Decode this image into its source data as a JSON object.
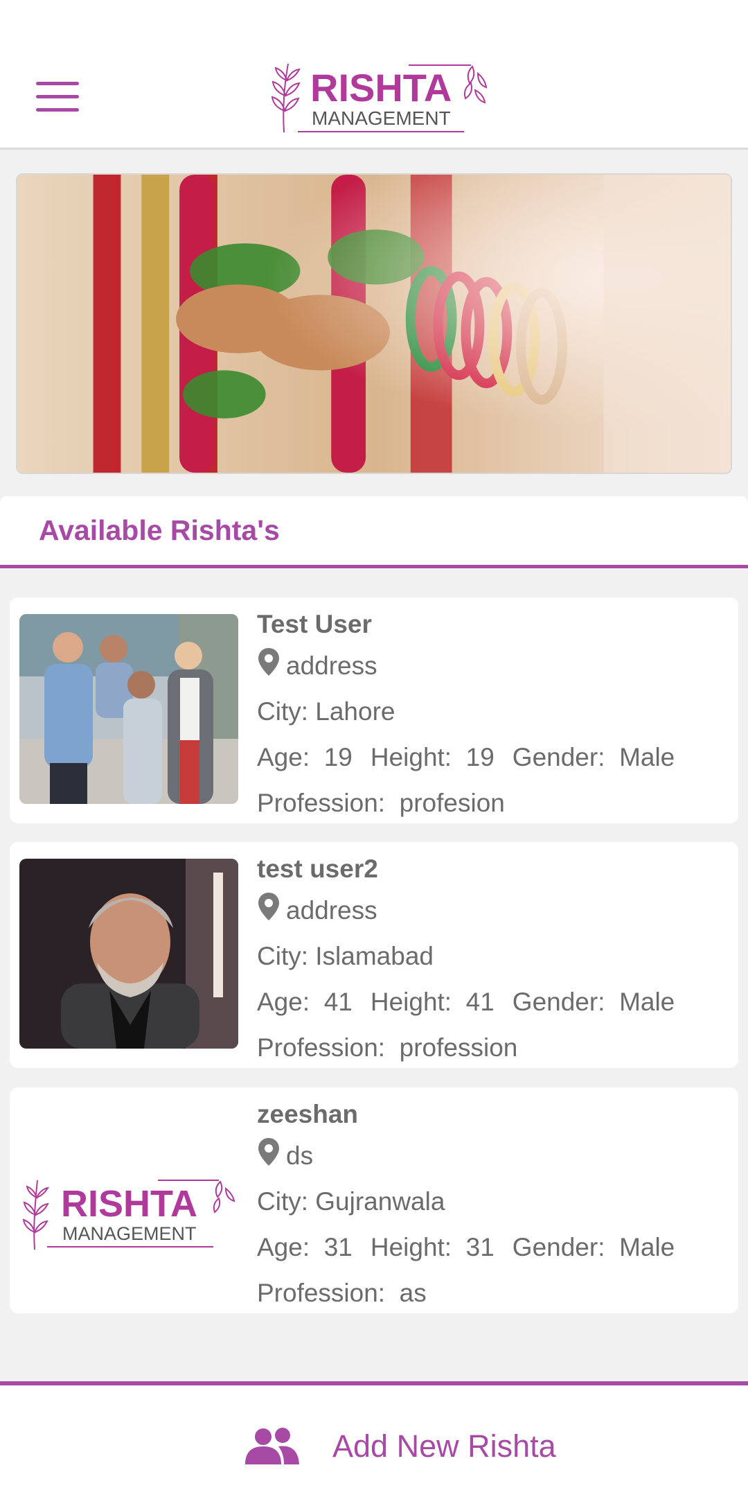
{
  "header": {
    "logo_title": "RISHTA",
    "logo_subtitle": "MANAGEMENT",
    "menu_icon": "hamburger-menu-icon"
  },
  "banner": {
    "description_icon": "wedding-banner-image"
  },
  "section": {
    "title": "Available Rishta's"
  },
  "labels": {
    "city": "City:",
    "age": "Age:",
    "height": "Height:",
    "gender": "Gender:",
    "profession": "Profession:"
  },
  "profiles": [
    {
      "name": "Test User",
      "address": "address",
      "city": "Lahore",
      "age": "19",
      "height": "19",
      "gender": "Male",
      "profession": "profesion"
    },
    {
      "name": "test user2",
      "address": "address",
      "city": "Islamabad",
      "age": "41",
      "height": "41",
      "gender": "Male",
      "profession": "profession"
    },
    {
      "name": "zeeshan",
      "address": "ds",
      "city": "Gujranwala",
      "age": "31",
      "height": "31",
      "gender": "Male",
      "profession": "as"
    }
  ],
  "footer": {
    "add_label": "Add New Rishta",
    "add_icon": "people-group-icon"
  },
  "colors": {
    "accent": "#a64aa6",
    "text": "#6b6b6b",
    "background": "#f2f1f2"
  }
}
